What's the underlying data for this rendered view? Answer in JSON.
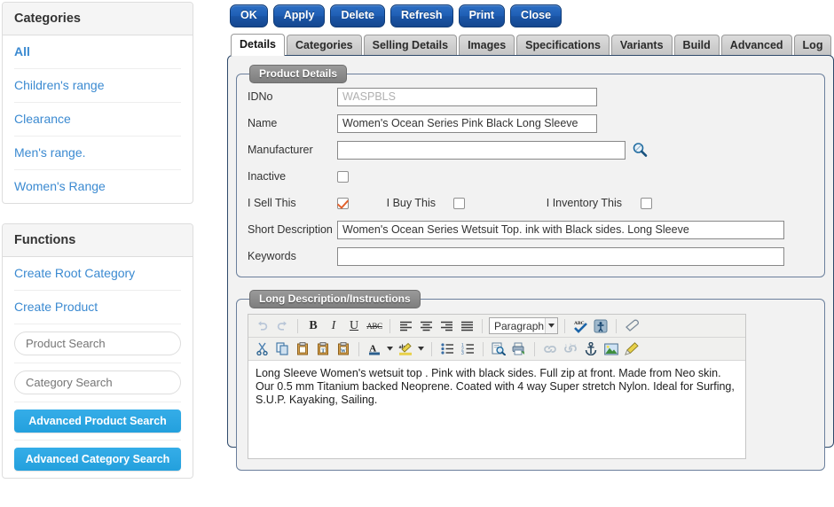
{
  "sidebar": {
    "categories_panel": {
      "title": "Categories",
      "items": [
        {
          "label": "All",
          "bold": true
        },
        {
          "label": "Children's range",
          "bold": false
        },
        {
          "label": "Clearance",
          "bold": false
        },
        {
          "label": "Men's range.",
          "bold": false
        },
        {
          "label": "Women's Range",
          "bold": false
        }
      ]
    },
    "functions_panel": {
      "title": "Functions",
      "links": [
        {
          "label": "Create Root Category"
        },
        {
          "label": "Create Product"
        }
      ],
      "product_search_placeholder": "Product Search",
      "category_search_placeholder": "Category Search",
      "product_search_value": "",
      "category_search_value": "",
      "advanced_product_search_label": "Advanced Product Search",
      "advanced_category_search_label": "Advanced Category Search"
    }
  },
  "toolbar": {
    "buttons": [
      {
        "label": "OK",
        "name": "ok-button"
      },
      {
        "label": "Apply",
        "name": "apply-button"
      },
      {
        "label": "Delete",
        "name": "delete-button"
      },
      {
        "label": "Refresh",
        "name": "refresh-button"
      },
      {
        "label": "Print",
        "name": "print-button"
      },
      {
        "label": "Close",
        "name": "close-button"
      }
    ]
  },
  "tabs": [
    {
      "label": "Details",
      "active": true
    },
    {
      "label": "Categories",
      "active": false
    },
    {
      "label": "Selling Details",
      "active": false
    },
    {
      "label": "Images",
      "active": false
    },
    {
      "label": "Specifications",
      "active": false
    },
    {
      "label": "Variants",
      "active": false
    },
    {
      "label": "Build",
      "active": false
    },
    {
      "label": "Advanced",
      "active": false
    },
    {
      "label": "Log",
      "active": false
    }
  ],
  "product_details": {
    "legend": "Product Details",
    "idno_label": "IDNo",
    "idno_value": "WASPBLS",
    "name_label": "Name",
    "name_value": "Women's Ocean Series Pink Black Long Sleeve",
    "manufacturer_label": "Manufacturer",
    "manufacturer_value": "",
    "inactive_label": "Inactive",
    "inactive_checked": false,
    "i_sell_this_label": "I Sell This",
    "i_sell_this_checked": true,
    "i_buy_this_label": "I Buy This",
    "i_buy_this_checked": false,
    "i_inventory_this_label": "I Inventory This",
    "i_inventory_this_checked": false,
    "short_description_label": "Short Description",
    "short_description_value": "Women's Ocean Series Wetsuit Top. ink with Black sides. Long Sleeve",
    "keywords_label": "Keywords",
    "keywords_value": ""
  },
  "long_description": {
    "legend": "Long Description/Instructions",
    "format_select_value": "Paragraph",
    "body_text": "Long Sleeve Women's wetsuit top . Pink with black sides. Full zip at front.  Made from Neo skin. Our 0.5 mm Titanium backed Neoprene. Coated with 4 way Super stretch Nylon.   Ideal for Surfing, S.U.P. Kayaking, Sailing.",
    "toolbar_row1": [
      "undo-icon",
      "redo-icon",
      "bold-icon",
      "italic-icon",
      "underline-icon",
      "strikethrough-icon",
      "align-left-icon",
      "align-center-icon",
      "align-right-icon",
      "align-justify-icon",
      "spellcheck-icon",
      "accessibility-icon",
      "remove-format-icon"
    ],
    "toolbar_row2": [
      "cut-icon",
      "copy-icon",
      "paste-icon",
      "paste-text-icon",
      "paste-word-icon",
      "text-color-icon",
      "highlight-color-icon",
      "bullet-list-icon",
      "numbered-list-icon",
      "find-replace-icon",
      "print-preview-icon",
      "link-icon",
      "unlink-icon",
      "anchor-icon",
      "insert-image-icon",
      "cleanup-icon"
    ]
  },
  "colors": {
    "link_blue": "#3b8ad1",
    "accent_blue": "#29a3e0",
    "toolbar_button_blue": "#1f5fb5",
    "checkbox_check_orange": "#e2622e",
    "panel_border_navy": "#2f4a6b"
  }
}
